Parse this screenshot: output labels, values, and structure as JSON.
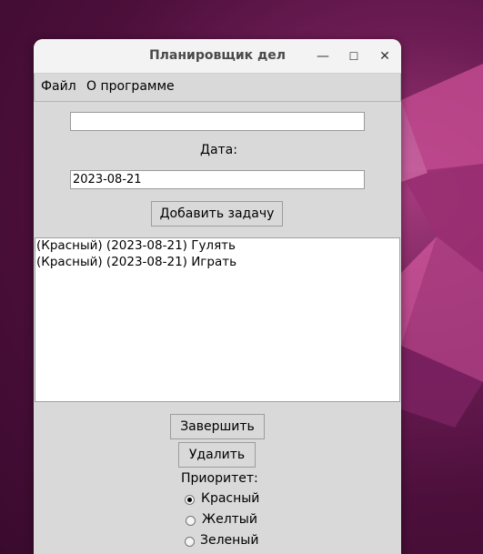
{
  "window": {
    "title": "Планировщик дел",
    "controls": {
      "minimize": "—",
      "maximize": "☐",
      "close": "✕"
    }
  },
  "menu": {
    "file": "Файл",
    "about": "О программе"
  },
  "form": {
    "task_value": "",
    "date_label": "Дата:",
    "date_value": "2023-08-21",
    "add_button": "Добавить задачу"
  },
  "tasks": [
    "(Красный) (2023-08-21) Гулять",
    "(Красный) (2023-08-21) Играть"
  ],
  "actions": {
    "complete": "Завершить",
    "delete": "Удалить"
  },
  "priority": {
    "label": "Приоритет:",
    "options": [
      "Красный",
      "Желтый",
      "Зеленый"
    ],
    "selected": "Красный"
  }
}
